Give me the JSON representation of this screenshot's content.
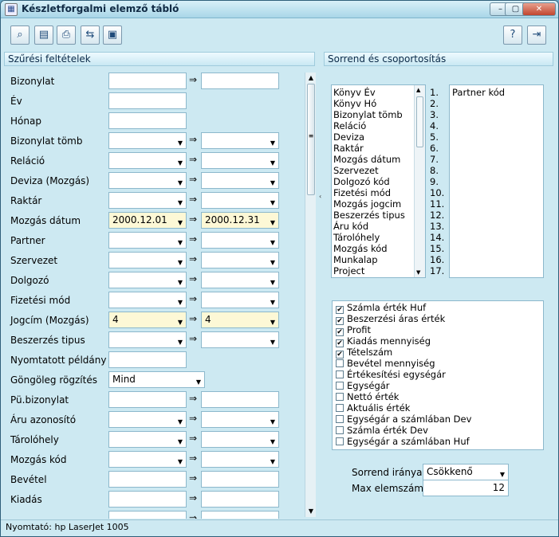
{
  "window": {
    "title": "Készletforgalmi elemző tábló",
    "app_icon": "app-icon",
    "min": "–",
    "max": "▢",
    "close": "✕"
  },
  "toolbar": {
    "icons": [
      "preview-icon",
      "calculator-icon",
      "print-icon",
      "export-icon",
      "save-icon"
    ],
    "help": "?",
    "exit": "⇥"
  },
  "left": {
    "header": "Szűrési feltételek",
    "rows": [
      {
        "label": "Bizonylat",
        "type": "text-range",
        "from": "",
        "to": ""
      },
      {
        "label": "Év",
        "type": "text",
        "value": ""
      },
      {
        "label": "Hónap",
        "type": "text",
        "value": ""
      },
      {
        "label": "Bizonylat tömb",
        "type": "combo-range",
        "from": "",
        "to": ""
      },
      {
        "label": "Reláció",
        "type": "combo-range",
        "from": "",
        "to": ""
      },
      {
        "label": "Deviza (Mozgás)",
        "type": "combo-range",
        "from": "",
        "to": ""
      },
      {
        "label": "Raktár",
        "type": "combo-range",
        "from": "",
        "to": ""
      },
      {
        "label": "Mozgás dátum",
        "type": "combo-range",
        "from": "2000.12.01",
        "to": "2000.12.31",
        "highlight": true
      },
      {
        "label": "Partner",
        "type": "combo-range",
        "from": "",
        "to": ""
      },
      {
        "label": "Szervezet",
        "type": "combo-range",
        "from": "",
        "to": ""
      },
      {
        "label": "Dolgozó",
        "type": "combo-range",
        "from": "",
        "to": ""
      },
      {
        "label": "Fizetési mód",
        "type": "combo-range",
        "from": "",
        "to": ""
      },
      {
        "label": "Jogcím (Mozgás)",
        "type": "combo-range",
        "from": "4",
        "to": "4",
        "highlight": true
      },
      {
        "label": "Beszerzés tipus",
        "type": "combo-range",
        "from": "",
        "to": ""
      },
      {
        "label": "Nyomtatott példány",
        "type": "text",
        "value": ""
      },
      {
        "label": "Göngöleg rögzítés",
        "type": "combo-wide",
        "value": "Mind"
      },
      {
        "label": "Pü.bizonylat",
        "type": "text-range",
        "from": "",
        "to": ""
      },
      {
        "label": "Áru azonosító",
        "type": "combo-range",
        "from": "",
        "to": ""
      },
      {
        "label": "Tárolóhely",
        "type": "combo-range",
        "from": "",
        "to": ""
      },
      {
        "label": "Mozgás kód",
        "type": "combo-range",
        "from": "",
        "to": ""
      },
      {
        "label": "Bevétel",
        "type": "text-range",
        "from": "",
        "to": ""
      },
      {
        "label": "Kiadás",
        "type": "text-range",
        "from": "",
        "to": ""
      },
      {
        "label": "",
        "type": "text-range",
        "from": "",
        "to": ""
      }
    ],
    "arrow": "⇒"
  },
  "right": {
    "header": "Sorrend és csoportosítás",
    "fields": [
      "Könyv Év",
      "Könyv Hó",
      "Bizonylat tömb",
      "Reláció",
      "Deviza",
      "Raktár",
      "Mozgás dátum",
      "Szervezet",
      "Dolgozó kód",
      "Fizetési mód",
      "Mozgás jogcim",
      "Beszerzés tipus",
      "Áru kód",
      "Tárolóhely",
      "Mozgás kód",
      "Munkalap",
      "Project"
    ],
    "numbers": [
      "1.",
      "2.",
      "3.",
      "4.",
      "5.",
      "6.",
      "7.",
      "8.",
      "9.",
      "10.",
      "11.",
      "12.",
      "13.",
      "14.",
      "15.",
      "16.",
      "17."
    ],
    "selected": [
      "Partner kód"
    ],
    "checks": [
      {
        "label": "Számla érték Huf",
        "checked": true
      },
      {
        "label": "Beszerzési áras érték",
        "checked": true
      },
      {
        "label": "Profit",
        "checked": true
      },
      {
        "label": "Kiadás mennyiség",
        "checked": true
      },
      {
        "label": "Tételszám",
        "checked": true
      },
      {
        "label": "Bevétel mennyiség",
        "checked": false
      },
      {
        "label": "Értékesítési egységár",
        "checked": false
      },
      {
        "label": "Egységár",
        "checked": false
      },
      {
        "label": "Nettó érték",
        "checked": false
      },
      {
        "label": "Aktuális érték",
        "checked": false
      },
      {
        "label": "Egységár a számlában Dev",
        "checked": false
      },
      {
        "label": "Számla érték Dev",
        "checked": false
      },
      {
        "label": "Egységár a számlában Huf",
        "checked": false
      }
    ],
    "order_label": "Sorrend iránya:",
    "order_value": "Csökkenő",
    "max_label": "Max elemszám:",
    "max_value": "12"
  },
  "status": "Nyomtató: hp LaserJet 1005"
}
